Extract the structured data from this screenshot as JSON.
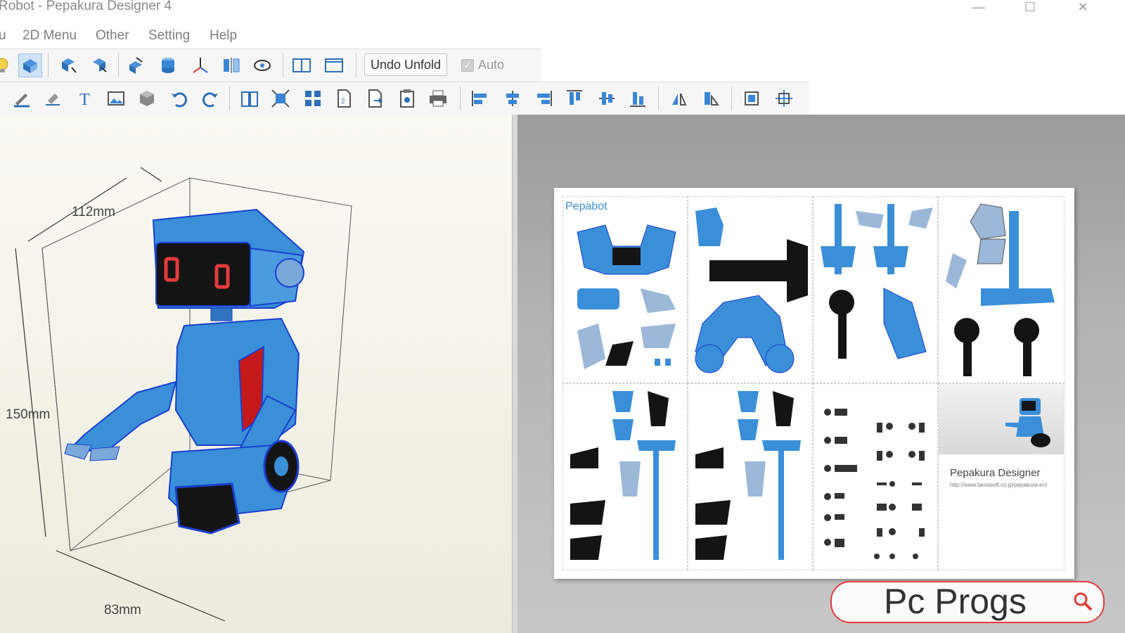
{
  "window": {
    "title": "Robot - Pepakura Designer 4",
    "controls": {
      "minimize": "—",
      "maximize": "☐",
      "close": "✕"
    }
  },
  "menubar": {
    "items": [
      {
        "label": "u"
      },
      {
        "label": "2D Menu"
      },
      {
        "label": "Other"
      },
      {
        "label": "Setting"
      },
      {
        "label": "Help"
      }
    ]
  },
  "toolbar1": {
    "icons": [
      "bulb-icon",
      "open-model-icon",
      "rotate-left-icon",
      "rotate-right-icon",
      "select-face-icon",
      "cylinder-icon",
      "axis-icon",
      "mirror-icon",
      "view-icon",
      "split-view-icon",
      "single-view-icon"
    ],
    "undo_unfold_label": "Undo Unfold",
    "auto_label": "Auto",
    "auto_checked": true
  },
  "toolbar2": {
    "icons": [
      "pen-icon",
      "eraser-icon",
      "text-icon",
      "image-icon",
      "cube-icon",
      "undo-icon",
      "redo-icon",
      "book-icon",
      "fit-icon",
      "grid-icon",
      "page-icon",
      "page-export-icon",
      "clipboard-icon",
      "print-icon",
      "align-left-icon",
      "align-center-icon",
      "align-right-icon",
      "align-top-icon",
      "align-middle-icon",
      "align-bottom-icon",
      "flip-h-icon",
      "flip-v-icon",
      "group-icon",
      "ungroup-icon"
    ]
  },
  "model_view": {
    "dimensions": {
      "width_label": "112mm",
      "height_label": "150mm",
      "depth_label": "83mm"
    }
  },
  "paper": {
    "label": "Pepabot",
    "brand_caption": "Pepakura Designer",
    "brand_url": "http://www.tamasoft.co.jp/pepakura-en/"
  },
  "watermark": {
    "text": "Pc Progs"
  },
  "colors": {
    "robot_blue": "#3a8fd8",
    "robot_dark": "#1a1a2e",
    "accent_red": "#e53b3b",
    "selection_blue": "#2a6fd0"
  }
}
